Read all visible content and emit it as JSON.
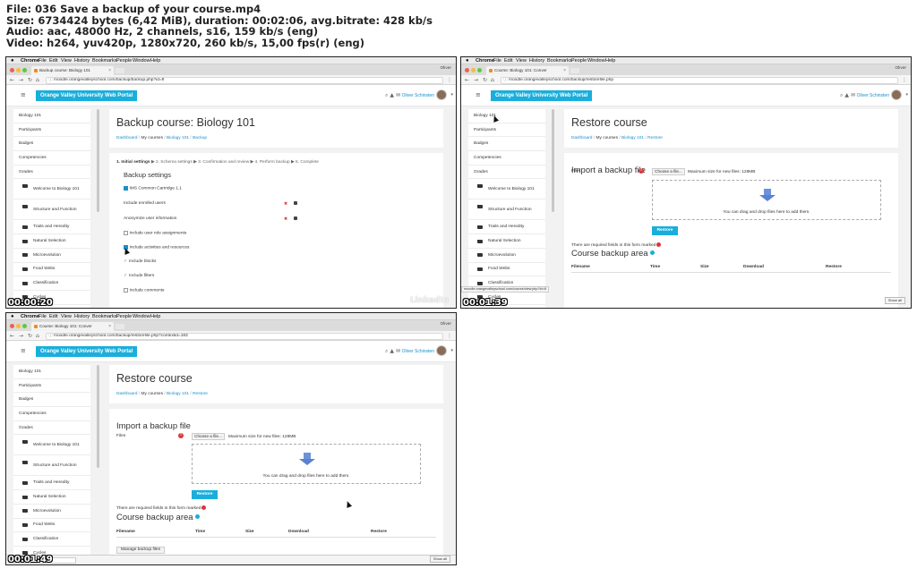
{
  "meta": {
    "file": "File: 036 Save a backup of your course.mp4",
    "size": "Size: 6734424 bytes (6,42 MiB), duration: 00:02:06, avg.bitrate: 428 kb/s",
    "audio": "Audio: aac, 48000 Hz, 2 channels, s16, 159 kb/s (eng)",
    "video": "Video: h264, yuv420p, 1280x720, 260 kb/s, 15,00 fps(r) (eng)"
  },
  "menubar": [
    "Chrome",
    "File",
    "Edit",
    "View",
    "History",
    "Bookmarks",
    "People",
    "Window",
    "Help"
  ],
  "user_short": "Oliver",
  "site": {
    "brand": "Orange Valley University Web Portal",
    "user": "Oliver Schinsten"
  },
  "sidebar": [
    {
      "label": "Biology 101",
      "ind": false
    },
    {
      "label": "Participants",
      "ind": false
    },
    {
      "label": "Badges",
      "ind": false
    },
    {
      "label": "Competencies",
      "ind": false
    },
    {
      "label": "Grades",
      "ind": false
    },
    {
      "label": "Welcome to Biology 101",
      "ind": true
    },
    {
      "label": "Structure and Function",
      "ind": true
    },
    {
      "label": "Traits and Heredity",
      "ind": true
    },
    {
      "label": "Natural Selection",
      "ind": true
    },
    {
      "label": "Microevolution",
      "ind": true
    },
    {
      "label": "Food Webs",
      "ind": true
    },
    {
      "label": "Classification",
      "ind": true
    },
    {
      "label": "Cycles",
      "ind": true
    }
  ],
  "f1": {
    "tab": "Backup course: Biology 101",
    "url": "moodle.orangevalleyschool.com/backup/backup.php?id=8",
    "title": "Backup course: Biology 101",
    "breadcrumb": [
      "Dashboard",
      "My courses",
      "Biology 101",
      "Backup"
    ],
    "steps": {
      "current": "1. Initial settings",
      "rest": "2. Schema settings ▶ 3. Confirmation and review ▶ 4. Perform backup ▶ 5. Complete"
    },
    "settings_title": "Backup settings",
    "rows": [
      "IMS Common Cartridge 1.1",
      "Include enrolled users",
      "Anonymize user information",
      "Include user role assignments",
      "Include activities and resources",
      "Include blocks",
      "Include filters",
      "Include comments"
    ],
    "time": "00:00:20",
    "watermark": "LinkedIn"
  },
  "f2": {
    "tab": "Course: Biology 101: Conver",
    "url": "moodle.orangevalleyschool.com/backup/restorefile.php",
    "status": "moodle.orangevalleyschool.com/course/view.php?id=8",
    "time": "00:01:39",
    "showall": "Show all"
  },
  "f3": {
    "tab": "Course: Biology 101: Conver",
    "url": "moodle.orangevalleyschool.com/backup/restorefile.php?contextid=183",
    "time": "00:01:49",
    "showall": "Show all",
    "manage": "Manage backup files"
  },
  "restore": {
    "title": "Restore course",
    "breadcrumb": [
      "Dashboard",
      "My courses",
      "Biology 101",
      "Restore"
    ],
    "import_title": "Import a backup file",
    "files_label": "Files",
    "choose_btn": "Choose a file...",
    "max_size": "Maximum size for new files: 128MB",
    "drop_text": "You can drag and drop files here to add them.",
    "restore_btn": "Restore",
    "required_text": "There are required fields in this form marked",
    "course_backup_title": "Course backup area",
    "columns": [
      "Filename",
      "Time",
      "Size",
      "Download",
      "Restore"
    ]
  },
  "colors": {
    "accent": "#1aaedb",
    "link": "#1a8fc9",
    "required": "#d9383a"
  }
}
